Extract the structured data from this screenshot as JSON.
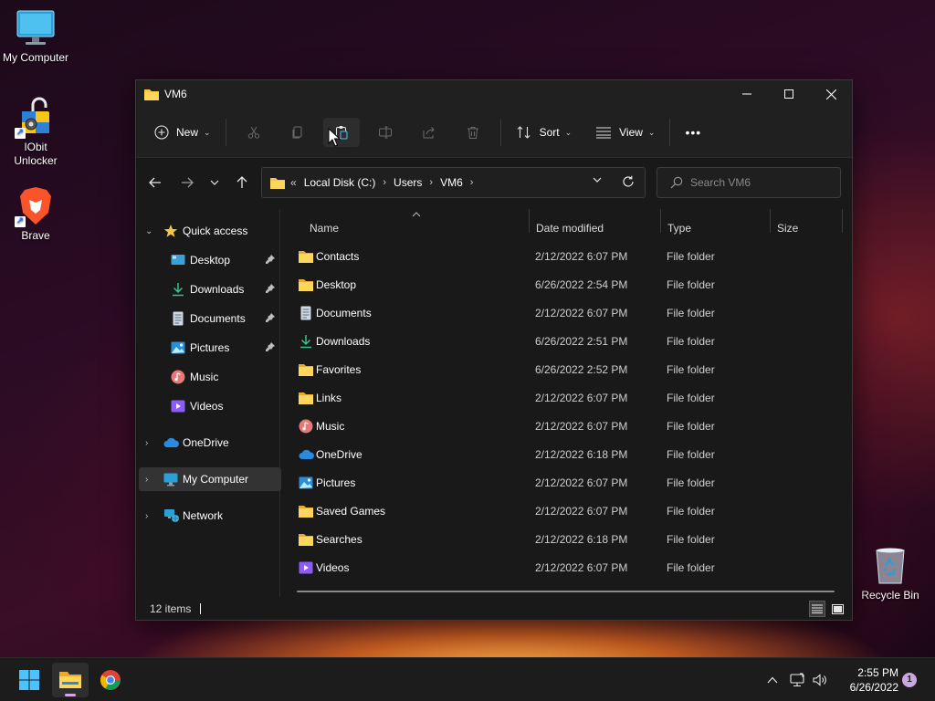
{
  "desktop": {
    "icons": [
      {
        "label": "My Computer",
        "icon": "monitor-icon"
      },
      {
        "label": "IObit\nUnlocker",
        "icon": "unlocker-icon"
      },
      {
        "label": "Brave",
        "icon": "brave-lion-icon"
      },
      {
        "label": "Recycle Bin",
        "icon": "recycle-bin-icon"
      }
    ]
  },
  "window": {
    "title": "VM6",
    "toolbar": {
      "new_label": "New",
      "sort_label": "Sort",
      "view_label": "View",
      "more_label": "•••"
    },
    "address": {
      "prefix": "«",
      "crumbs": [
        "Local Disk (C:)",
        "Users",
        "VM6"
      ]
    },
    "search": {
      "placeholder": "Search VM6"
    },
    "nav": {
      "quick_access": "Quick access",
      "items": [
        {
          "label": "Desktop",
          "icon": "desktop-icon",
          "pinned": true
        },
        {
          "label": "Downloads",
          "icon": "download-icon",
          "pinned": true
        },
        {
          "label": "Documents",
          "icon": "document-icon",
          "pinned": true
        },
        {
          "label": "Pictures",
          "icon": "pictures-icon",
          "pinned": true
        },
        {
          "label": "Music",
          "icon": "music-icon",
          "pinned": false
        },
        {
          "label": "Videos",
          "icon": "videos-icon",
          "pinned": false
        }
      ],
      "onedrive": "OneDrive",
      "my_computer": "My Computer",
      "network": "Network"
    },
    "columns": {
      "name": "Name",
      "date": "Date modified",
      "type": "Type",
      "size": "Size"
    },
    "files": [
      {
        "name": "Contacts",
        "date": "2/12/2022 6:07 PM",
        "type": "File folder",
        "icon": "folder-icon"
      },
      {
        "name": "Desktop",
        "date": "6/26/2022 2:54 PM",
        "type": "File folder",
        "icon": "folder-icon"
      },
      {
        "name": "Documents",
        "date": "2/12/2022 6:07 PM",
        "type": "File folder",
        "icon": "document-icon"
      },
      {
        "name": "Downloads",
        "date": "6/26/2022 2:51 PM",
        "type": "File folder",
        "icon": "download-icon"
      },
      {
        "name": "Favorites",
        "date": "6/26/2022 2:52 PM",
        "type": "File folder",
        "icon": "folder-icon"
      },
      {
        "name": "Links",
        "date": "2/12/2022 6:07 PM",
        "type": "File folder",
        "icon": "folder-icon"
      },
      {
        "name": "Music",
        "date": "2/12/2022 6:07 PM",
        "type": "File folder",
        "icon": "music-icon"
      },
      {
        "name": "OneDrive",
        "date": "2/12/2022 6:18 PM",
        "type": "File folder",
        "icon": "onedrive-icon"
      },
      {
        "name": "Pictures",
        "date": "2/12/2022 6:07 PM",
        "type": "File folder",
        "icon": "pictures-icon"
      },
      {
        "name": "Saved Games",
        "date": "2/12/2022 6:07 PM",
        "type": "File folder",
        "icon": "folder-icon"
      },
      {
        "name": "Searches",
        "date": "2/12/2022 6:18 PM",
        "type": "File folder",
        "icon": "folder-icon"
      },
      {
        "name": "Videos",
        "date": "2/12/2022 6:07 PM",
        "type": "File folder",
        "icon": "videos-icon"
      }
    ],
    "status": {
      "item_count": "12 items"
    }
  },
  "taskbar": {
    "apps": [
      "start-icon",
      "file-explorer-icon",
      "chrome-icon"
    ],
    "time": "2:55 PM",
    "date": "6/26/2022",
    "notification_count": "1"
  },
  "colors": {
    "folder": "#f3c54b",
    "accent": "#4cc2ff",
    "window_bg": "#191919"
  }
}
